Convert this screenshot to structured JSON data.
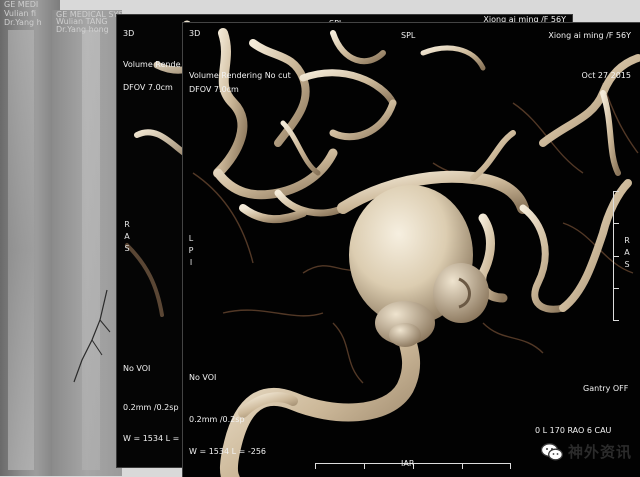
{
  "windows": [
    {
      "id": "w1",
      "top_left": [
        "GE MEDI",
        "Vulian fi",
        "Dr.Yang h"
      ]
    },
    {
      "id": "w2",
      "top_left": [
        "GE MEDICAL SYSTEMS",
        "Wulian TANG",
        "Dr.Yang hong"
      ]
    },
    {
      "id": "w3",
      "top_left": [
        "3D",
        "",
        "Volume Rende",
        "",
        "DFOV 7.0cm"
      ],
      "top_center": "SPL",
      "top_right": [
        "Xiong ai ming /F 56Y"
      ],
      "left_mid": [
        "R",
        "A",
        "S"
      ],
      "bottom_left": [
        "No VOI",
        "",
        "0.2mm /0.2sp",
        "",
        "W = 1534  L = "
      ]
    },
    {
      "id": "w4",
      "top_left": [
        "3D",
        "",
        "Volume Rendering  No cut",
        "",
        "DFOV 7.0cm"
      ],
      "top_center": "SPL",
      "top_right": [
        "Xiong ai ming /F 56Y",
        "",
        "Oct 27 2015"
      ],
      "left_mid": [
        "L",
        "P",
        "I"
      ],
      "right_mid": [
        "R",
        "A",
        "S"
      ],
      "bottom_left": [
        "No VOI",
        "",
        "0.2mm /0.2sp",
        "",
        "W = 1534  L = -256"
      ],
      "bottom_right": [
        "Gantry OFF",
        "",
        "0 L 170  RAO 6  CAU"
      ],
      "bottom_center": "IAR"
    }
  ],
  "watermark": {
    "icon": "wechat-icon",
    "text": "神外资讯"
  },
  "colors": {
    "vessel": "#d8c7ad",
    "aneurysm": "#e8dcc5",
    "background": "#030303"
  }
}
